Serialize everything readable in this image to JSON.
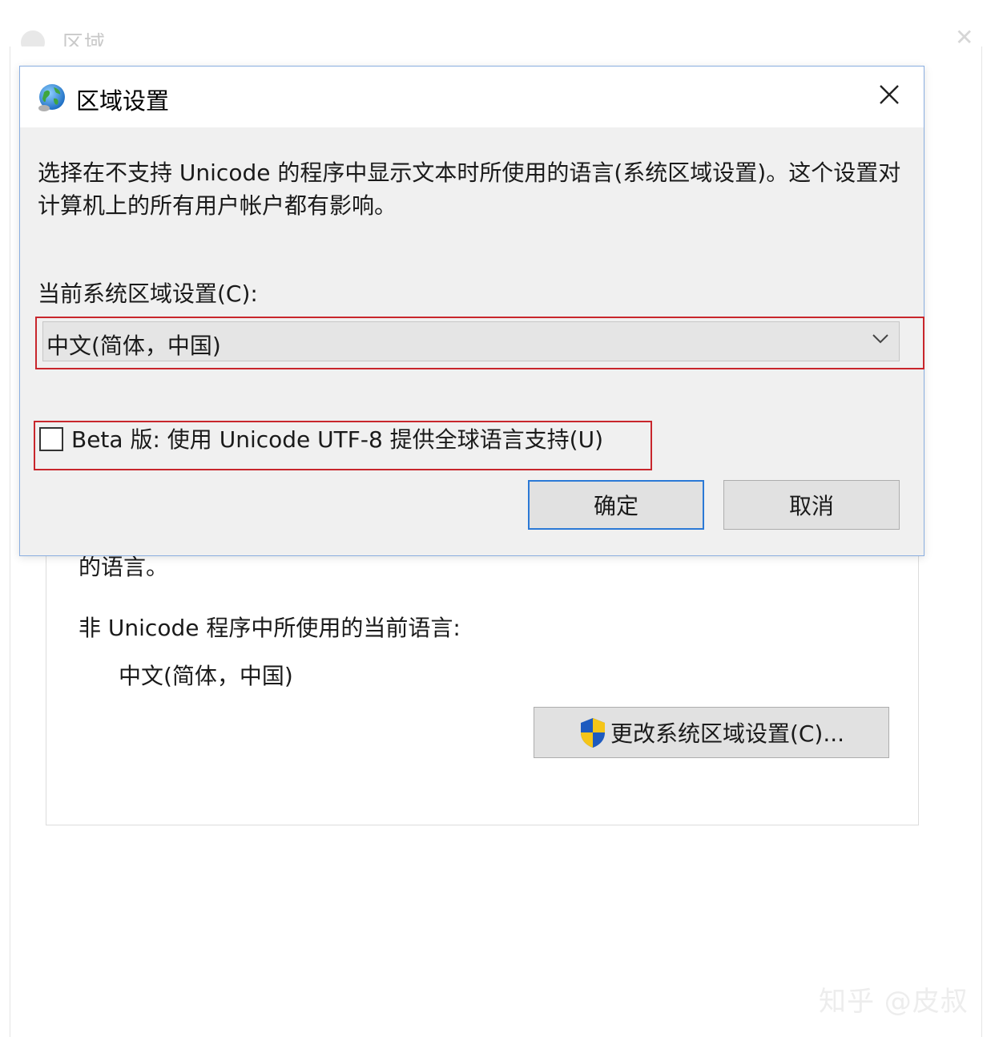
{
  "background_window": {
    "title": "区域",
    "partial_text": "的语言。",
    "non_unicode_label": "非 Unicode 程序中所使用的当前语言:",
    "non_unicode_value": "中文(简体，中国)",
    "change_button_label": "更改系统区域设置(C)..."
  },
  "dialog": {
    "title": "区域设置",
    "description": "选择在不支持 Unicode 的程序中显示文本时所使用的语言(系统区域设置)。这个设置对计算机上的所有用户帐户都有影响。",
    "current_label": "当前系统区域设置(C):",
    "current_value": "中文(简体，中国)",
    "beta_label": "Beta 版: 使用 Unicode UTF-8 提供全球语言支持(U)",
    "beta_checked": false,
    "ok_label": "确定",
    "cancel_label": "取消"
  },
  "watermark": "知乎 @皮叔",
  "colors": {
    "highlight_red": "#c8262c",
    "focus_blue": "#2b79d6",
    "dialog_bg": "#f0f0f0"
  },
  "icons": [
    "globe-icon",
    "close-icon",
    "chevron-down-icon",
    "uac-shield-icon"
  ]
}
